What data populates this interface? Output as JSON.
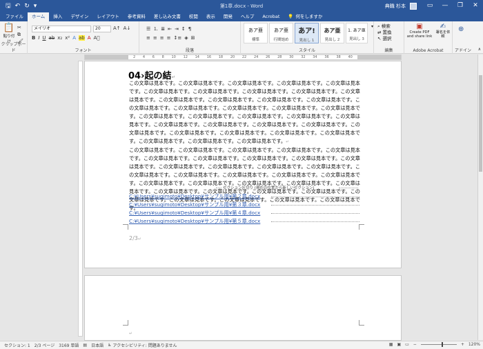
{
  "titlebar": {
    "doc_title": "第1章.docx  -  Word",
    "user_name": "典職 杉本",
    "save_icon": "save-icon",
    "undo_icon": "undo-icon",
    "redo_icon": "redo-icon",
    "minimize": "—",
    "restore": "❐",
    "close": "✕"
  },
  "tabs": [
    "ファイル",
    "ホーム",
    "挿入",
    "デザイン",
    "レイアウト",
    "参考資料",
    "差し込み文書",
    "校閲",
    "表示",
    "開発",
    "ヘルプ",
    "Acrobat"
  ],
  "active_tab": "ホーム",
  "tell_me": "何をしますか",
  "ribbon": {
    "clipboard": {
      "paste": "貼り付け",
      "label": "クリップボード"
    },
    "font": {
      "name": "メイリオ",
      "size": "20",
      "label": "フォント"
    },
    "paragraph": {
      "label": "段落"
    },
    "styles": {
      "items": [
        {
          "preview": "あア亜",
          "name": "標準"
        },
        {
          "preview": "あア亜",
          "name": "行間詰め"
        },
        {
          "preview": "あア!",
          "name": "見出し 1"
        },
        {
          "preview": "あア亜",
          "name": "見出し 2"
        },
        {
          "preview": "1. あア亜",
          "name": "見出し 3"
        }
      ],
      "label": "スタイル"
    },
    "editing": {
      "find": "検索",
      "replace": "置換",
      "select": "選択",
      "label": "編集"
    },
    "acrobat": {
      "create": "Create PDF and share link",
      "request": "署名を依頼",
      "label": "Adobe Acrobat"
    },
    "addin_label": "アドイン"
  },
  "ruler_numbers": [
    "2",
    "4",
    "6",
    "8",
    "10",
    "12",
    "14",
    "16",
    "18",
    "20",
    "22",
    "24",
    "26",
    "28",
    "30",
    "32",
    "34",
    "36",
    "38",
    "40"
  ],
  "document": {
    "heading": "04›起の結",
    "paragraph1": "この文章は見本です。この文章は見本です。この文章は見本です。この文章は見本です。この文章は見本です。この文章は見本です。この文章は見本です。この文章は見本です。この文章は見本です。この文章は見本です。この文章は見本です。この文章は見本です。この文章は見本です。この文章は見本です。この文章は見本です。この文章は見本です。この文章は見本です。この文章は見本です。この文章は見本です。この文章は見本です。この文章は見本です。この文章は見本です。この文章は見本です。この文章は見本です。この文章は見本です。この文章は見本です。この文章は見本です。この文章は見本です。この文章は見本です。この文章は見本です。この文章は見本です。この文章は見本です。この文章は見本です。この文章は見本です。この文章は見本です。この文章は見本です。",
    "paragraph2": "この文章は見本です。この文章は見本です。この文章は見本です。この文章は見本です。この文章は見本です。この文章は見本です。この文章は見本です。この文章は見本です。この文章は見本です。この文章は見本です。この文章は見本です。この文章は見本です。この文章は見本です。この文章は見本です。この文章は見本です。この文章は見本です。この文章は見本です。この文章は見本です。この文章は見本です。この文章は見本です。この文章は見本です。この文章は見本です。この文章は見本です。この文章は見本です。この文章は見本です。この文章は見本です。この文章は見本です。この文章は見本です。この文章は見本です。この文章は見本です。この文章は見本です。この文章は見本です。この文章は見本です。",
    "section_break": "セクション区切り (現在の位置から新しいセクション)",
    "links": [
      "C:¥Users¥sugimoto¥Desktop¥サンプル用¥第２章.docx",
      "C:¥Users¥sugimoto¥Desktop¥サンプル用¥第３章.docx",
      "C:¥Users¥sugimoto¥Desktop¥サンプル用¥第４章.docx",
      "C:¥Users¥sugimoto¥Desktop¥サンプル用¥第５章.docx"
    ],
    "page_number": "2/3",
    "para_mark": "↵"
  },
  "statusbar": {
    "section": "セクション: 1",
    "page": "2/3 ページ",
    "words": "3169 単語",
    "language": "日本語",
    "accessibility": "アクセシビリティ: 問題ありません",
    "zoom": "120%"
  },
  "colors": {
    "word_blue": "#2b579a",
    "link_blue": "#2e5bb0"
  }
}
